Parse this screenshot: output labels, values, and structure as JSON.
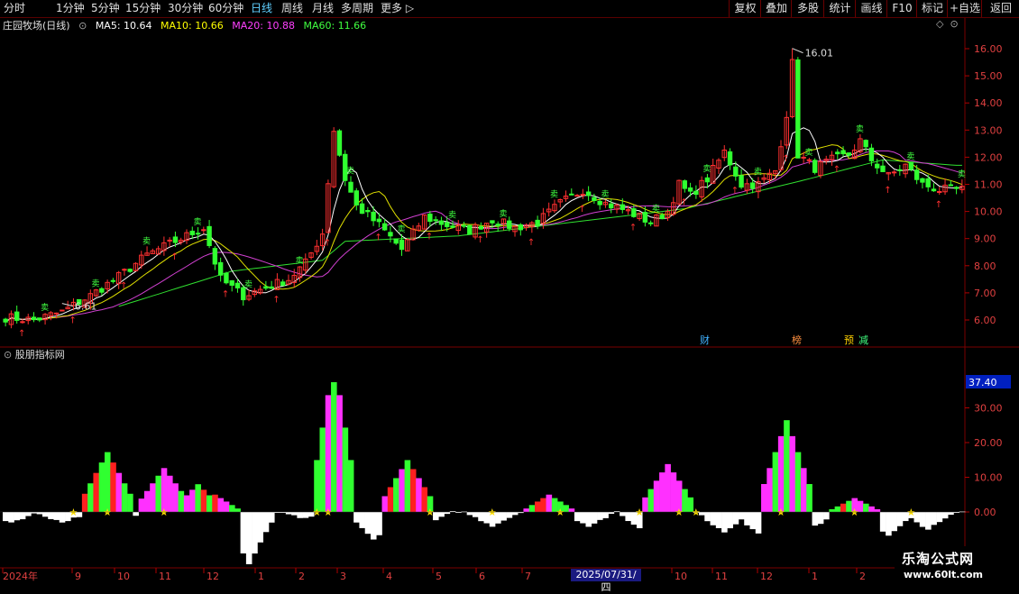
{
  "toolbar": {
    "left": [
      "分时",
      "1分钟",
      "5分钟",
      "15分钟",
      "30分钟",
      "60分钟",
      "日线",
      "周线",
      "月线",
      "多周期",
      "更多 ▷"
    ],
    "active": "日线",
    "right": [
      "复权",
      "叠加",
      "多股",
      "统计",
      "画线",
      "F10",
      "标记",
      "+自选",
      "返回"
    ]
  },
  "header": {
    "stock": "庄园牧场(日线)",
    "ma5": "MA5: 10.64",
    "ma10": "MA10: 10.66",
    "ma20": "MA20: 10.88",
    "ma60": "MA60: 11.66",
    "colors": {
      "ma5": "#ffffff",
      "ma10": "#ffff00",
      "ma20": "#ff40ff",
      "ma60": "#40ff40"
    }
  },
  "indicator": {
    "title": "股朋指标网",
    "current_value": "37.40"
  },
  "price_axis": [
    "16.00",
    "15.00",
    "14.00",
    "13.00",
    "12.00",
    "11.00",
    "10.00",
    "9.00",
    "8.00",
    "7.00",
    "6.00"
  ],
  "ind_axis": [
    "30.00",
    "20.00",
    "10.00",
    "0.00"
  ],
  "x_labels": [
    "2024年",
    "9",
    "10",
    "11",
    "12",
    "1",
    "2",
    "3",
    "4",
    "5",
    "6",
    "7",
    "10",
    "11",
    "12",
    "1",
    "2"
  ],
  "crosshair_date": "2025/07/31/四",
  "annotations": {
    "high": "16.01",
    "low": "6.61"
  },
  "event_tags": [
    "财",
    "榜",
    "预",
    "减"
  ],
  "watermark": {
    "line1": "乐淘公式网",
    "line2": "www.60lt.com"
  },
  "chart_data": [
    {
      "type": "candlestick",
      "title": "庄园牧场(日线)",
      "ylim": [
        5.5,
        16.5
      ],
      "close_trend": [
        [
          0,
          6.1
        ],
        [
          5,
          6.0
        ],
        [
          10,
          6.3
        ],
        [
          15,
          6.9
        ],
        [
          20,
          7.6
        ],
        [
          25,
          8.4
        ],
        [
          30,
          8.9
        ],
        [
          35,
          9.4
        ],
        [
          38,
          7.5
        ],
        [
          42,
          6.9
        ],
        [
          46,
          7.2
        ],
        [
          50,
          7.5
        ],
        [
          53,
          8.1
        ],
        [
          56,
          9.2
        ],
        [
          58,
          13.0
        ],
        [
          60,
          11.2
        ],
        [
          62,
          10.2
        ],
        [
          66,
          9.5
        ],
        [
          70,
          8.6
        ],
        [
          74,
          9.8
        ],
        [
          78,
          9.5
        ],
        [
          82,
          9.3
        ],
        [
          86,
          9.7
        ],
        [
          90,
          9.4
        ],
        [
          94,
          9.6
        ],
        [
          98,
          10.3
        ],
        [
          102,
          10.8
        ],
        [
          106,
          10.3
        ],
        [
          110,
          10.0
        ],
        [
          114,
          9.6
        ],
        [
          117,
          10.0
        ],
        [
          119,
          11.0
        ],
        [
          121,
          10.6
        ],
        [
          124,
          11.2
        ],
        [
          127,
          12.2
        ],
        [
          130,
          11.0
        ],
        [
          133,
          11.0
        ],
        [
          136,
          11.5
        ],
        [
          138,
          13.6
        ],
        [
          140,
          12.1
        ],
        [
          143,
          11.6
        ],
        [
          146,
          11.9
        ],
        [
          149,
          12.1
        ],
        [
          151,
          12.6
        ],
        [
          153,
          11.9
        ],
        [
          156,
          11.3
        ],
        [
          159,
          11.7
        ],
        [
          162,
          11.0
        ],
        [
          165,
          10.8
        ]
      ],
      "high_day": 139,
      "high": 16.01,
      "low_day": 10,
      "low": 6.61,
      "ma60": [
        [
          20,
          6.5
        ],
        [
          40,
          7.8
        ],
        [
          56,
          8.2
        ],
        [
          60,
          8.9
        ],
        [
          80,
          9.1
        ],
        [
          100,
          9.6
        ],
        [
          120,
          10.1
        ],
        [
          140,
          11.1
        ],
        [
          155,
          11.9
        ],
        [
          168,
          11.7
        ]
      ]
    },
    {
      "type": "bar",
      "title": "股朋指标网",
      "ylim": [
        -15,
        42
      ],
      "last_value": 37.4,
      "peaks": [
        [
          18,
          15
        ],
        [
          28,
          11
        ],
        [
          34,
          8
        ],
        [
          37,
          5
        ],
        [
          58,
          37.4
        ],
        [
          71,
          13
        ],
        [
          96,
          5
        ],
        [
          117,
          12
        ],
        [
          138,
          23
        ],
        [
          150,
          4
        ]
      ],
      "troughs": [
        [
          1,
          -3
        ],
        [
          10,
          -3
        ],
        [
          20,
          -2
        ],
        [
          43,
          -15
        ],
        [
          53,
          -2
        ],
        [
          65,
          -8
        ],
        [
          74,
          -4
        ],
        [
          86,
          -4
        ],
        [
          103,
          -4
        ],
        [
          113,
          -6
        ],
        [
          127,
          -6
        ],
        [
          133,
          -6
        ],
        [
          143,
          -4
        ],
        [
          156,
          -7
        ],
        [
          163,
          -5
        ]
      ]
    }
  ]
}
